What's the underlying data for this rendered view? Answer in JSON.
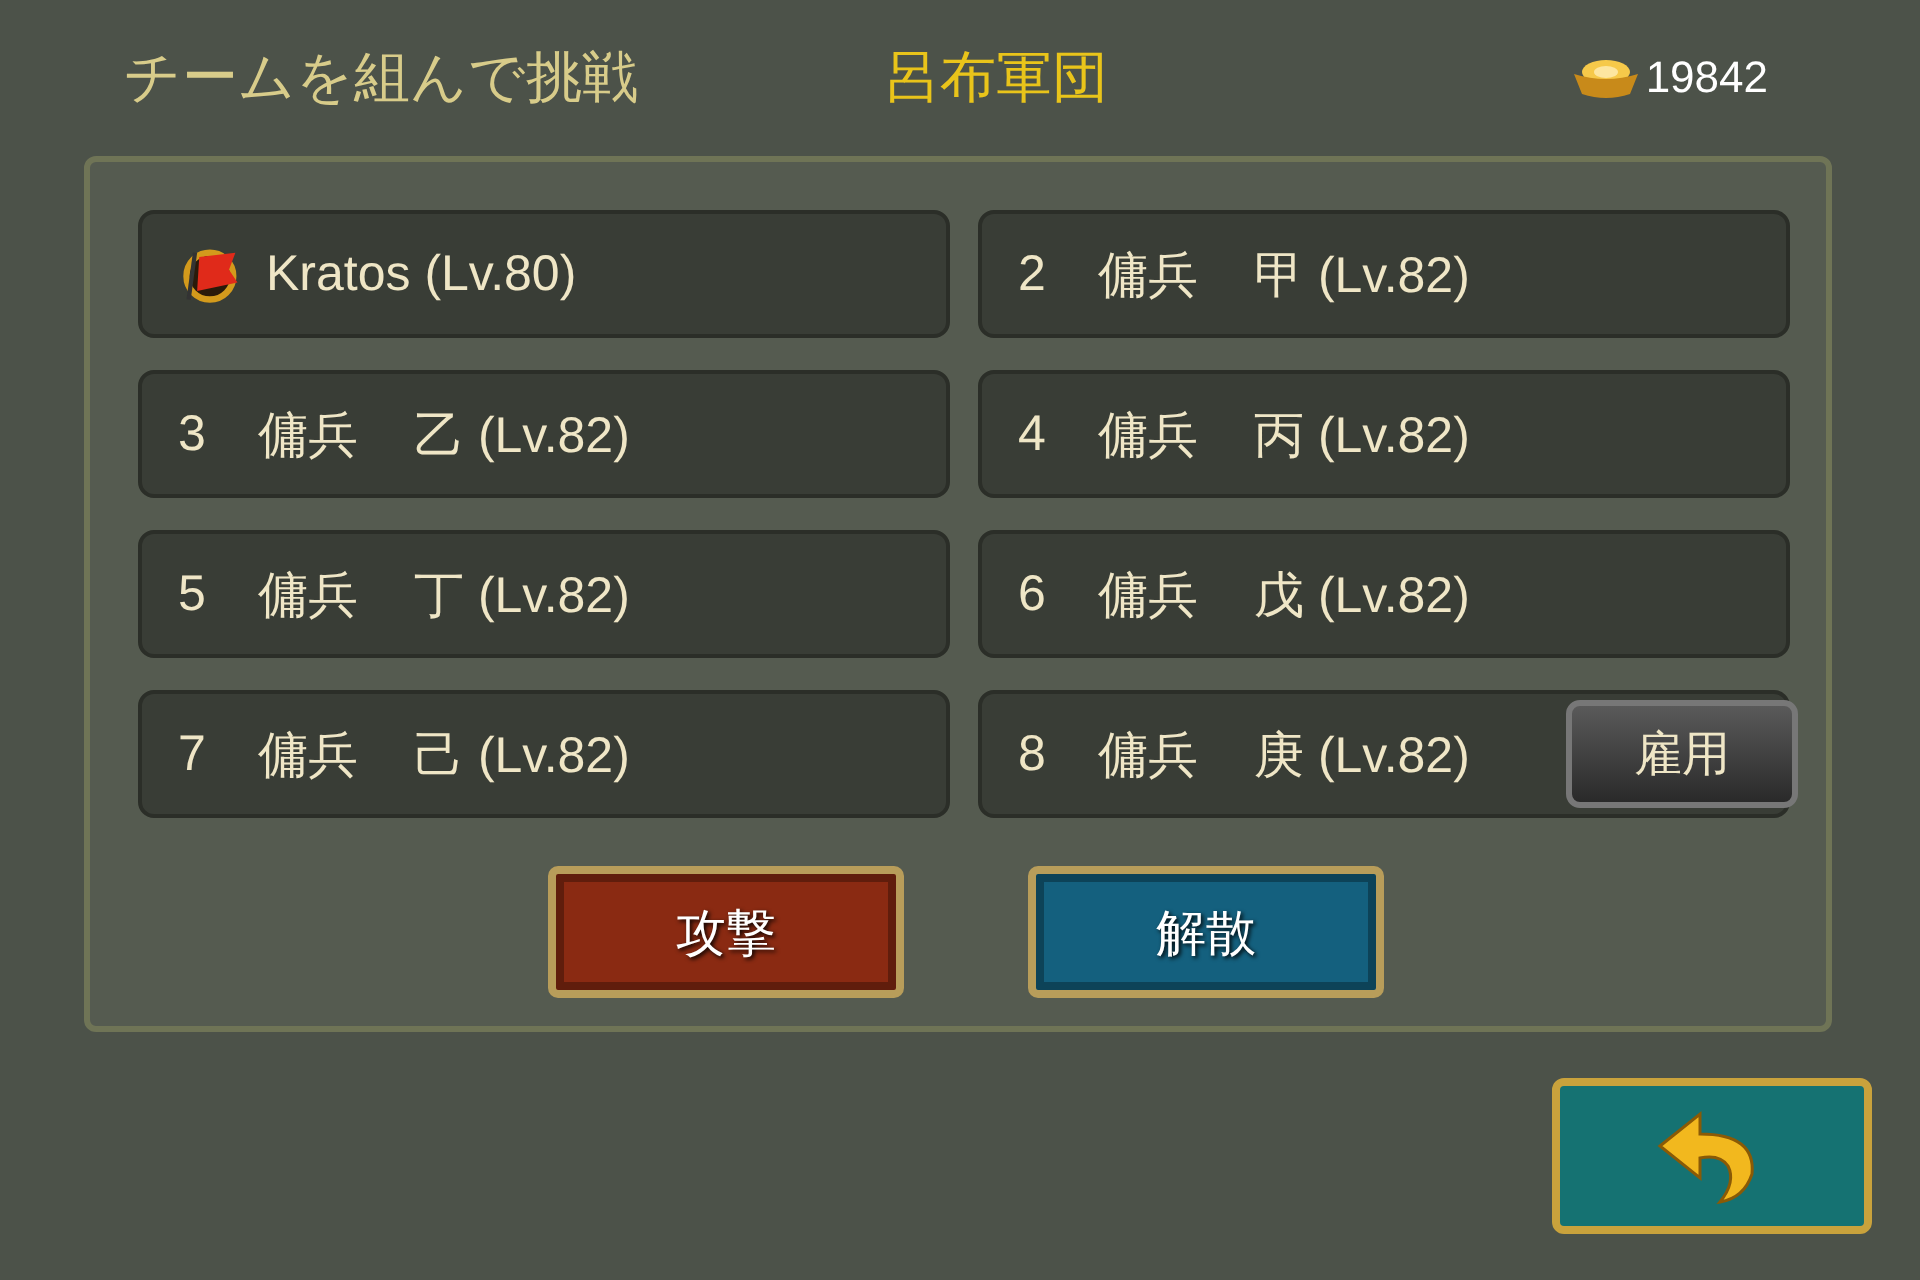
{
  "header": {
    "title": "チームを組んで挑戦",
    "team_name": "呂布軍団",
    "currency": "19842"
  },
  "slots": [
    {
      "kind": "player",
      "name": "Kratos (Lv.80)"
    },
    {
      "kind": "mercenary",
      "number": "2",
      "unit": "傭兵",
      "name": "甲 (Lv.82)"
    },
    {
      "kind": "mercenary",
      "number": "3",
      "unit": "傭兵",
      "name": "乙 (Lv.82)"
    },
    {
      "kind": "mercenary",
      "number": "4",
      "unit": "傭兵",
      "name": "丙 (Lv.82)"
    },
    {
      "kind": "mercenary",
      "number": "5",
      "unit": "傭兵",
      "name": "丁 (Lv.82)"
    },
    {
      "kind": "mercenary",
      "number": "6",
      "unit": "傭兵",
      "name": "戊 (Lv.82)"
    },
    {
      "kind": "mercenary",
      "number": "7",
      "unit": "傭兵",
      "name": "己 (Lv.82)"
    },
    {
      "kind": "mercenary",
      "number": "8",
      "unit": "傭兵",
      "name": "庚 (Lv.82)",
      "hire_button": "雇用"
    }
  ],
  "actions": [
    {
      "kind": "attack",
      "label": "攻撃"
    },
    {
      "kind": "disband",
      "label": "解散"
    }
  ]
}
